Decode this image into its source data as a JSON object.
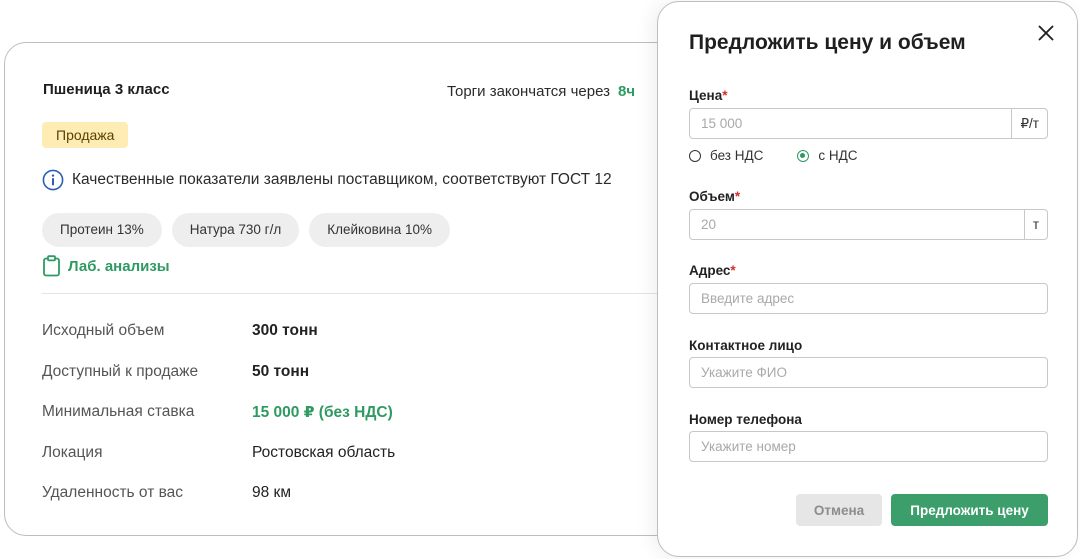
{
  "lot": {
    "title": "Пшеница 3 класс",
    "auction_label": "Торги закончатся через",
    "auction_time": "8ч",
    "badge": "Продажа",
    "quality_text": "Качественные показатели заявлены поставщиком, соответствуют ГОСТ 12",
    "chips": [
      "Протеин 13%",
      "Натура 730 г/л",
      "Клейковина 10%"
    ],
    "lab_link": "Лаб. анализы",
    "properties": [
      {
        "label": "Исходный объем",
        "value": "300 тонн"
      },
      {
        "label": "Доступный к продаже",
        "value": "50 тонн"
      },
      {
        "label": "Минимальная ставка",
        "value": "15 000 ₽ (без НДС)"
      },
      {
        "label": "Локация",
        "value": "Ростовская область"
      },
      {
        "label": "Удаленность от вас",
        "value": "98 км"
      }
    ]
  },
  "modal": {
    "title": "Предложить цену и объем",
    "price": {
      "label": "Цена",
      "placeholder": "15 000",
      "unit": "₽/т"
    },
    "vat_options": [
      {
        "label": "без НДС",
        "selected": false
      },
      {
        "label": "с НДС",
        "selected": true
      }
    ],
    "volume": {
      "label": "Объем",
      "placeholder": "20",
      "unit": "т"
    },
    "address": {
      "label": "Адрес",
      "placeholder": "Введите адрес"
    },
    "contact": {
      "label": "Контактное лицо",
      "placeholder": "Укажите ФИО"
    },
    "phone": {
      "label": "Номер телефона",
      "placeholder": "Укажите номер"
    },
    "required_mark": "*",
    "cancel_label": "Отмена",
    "submit_label": "Предложить цену"
  },
  "colors": {
    "accent": "#2e9a62",
    "badge_bg": "#fdecb3",
    "required": "#d62b2b",
    "info_icon": "#2a5fb3"
  },
  "icons": {
    "info": "info-circle-icon",
    "lab": "clipboard-icon",
    "close": "close-icon"
  }
}
